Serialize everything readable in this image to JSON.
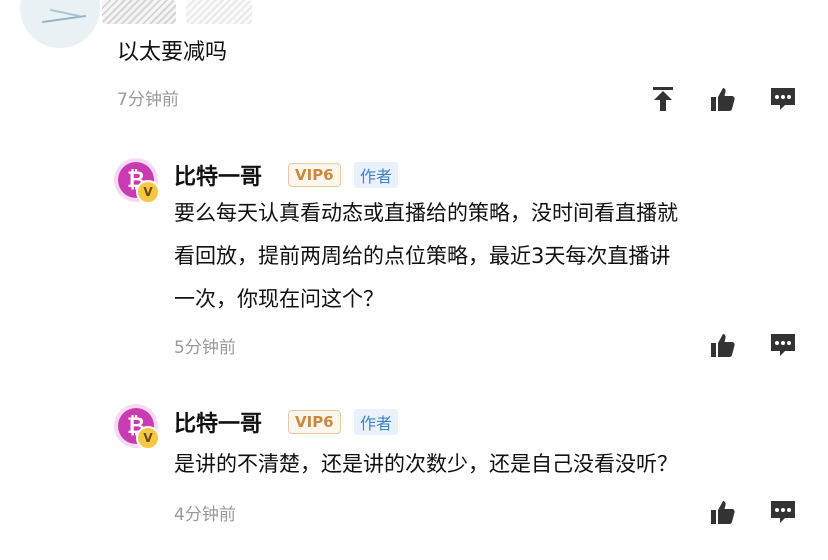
{
  "top_comment": {
    "text": "以太要减吗",
    "time": "7分钟前"
  },
  "replies": [
    {
      "username": "比特一哥",
      "vip": "VIP6",
      "tag": "作者",
      "lines": [
        "要么每天认真看动态或直播给的策略，没时间看直播就",
        "看回放，提前两周给的点位策略，最近3天每次直播讲",
        "一次，你现在问这个？"
      ],
      "time": "5分钟前"
    },
    {
      "username": "比特一哥",
      "vip": "VIP6",
      "tag": "作者",
      "lines": [
        "是讲的不清楚，还是讲的次数少，还是自己没看没听？"
      ],
      "time": "4分钟前"
    }
  ],
  "avatar_glyph": "₿",
  "avatar_badge": "V",
  "icons": [
    "pin-top-icon",
    "thumbs-up-icon",
    "comment-icon"
  ],
  "colors": {
    "vip_text": "#c98a3e",
    "author_text": "#3f82c8",
    "avatar": "#c93bb2",
    "muted": "#9a9a9a"
  }
}
